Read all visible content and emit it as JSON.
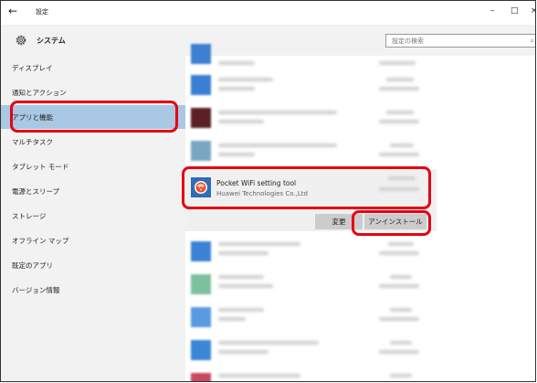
{
  "window": {
    "back_glyph": "←",
    "title": "設定",
    "controls": {
      "minimize": "–",
      "maximize": "□",
      "close": "×"
    }
  },
  "header": {
    "section_title": "システム",
    "search": {
      "placeholder": "設定の検索"
    }
  },
  "sidebar": {
    "items": [
      {
        "label": "ディスプレイ",
        "active": false
      },
      {
        "label": "通知とアクション",
        "active": false
      },
      {
        "label": "アプリと機能",
        "active": true
      },
      {
        "label": "マルチタスク",
        "active": false
      },
      {
        "label": "タブレット モード",
        "active": false
      },
      {
        "label": "電源とスリープ",
        "active": false
      },
      {
        "label": "ストレージ",
        "active": false
      },
      {
        "label": "オフライン マップ",
        "active": false
      },
      {
        "label": "既定のアプリ",
        "active": false
      },
      {
        "label": "バージョン情報",
        "active": false
      }
    ]
  },
  "apps": {
    "selected": {
      "name": "Pocket WiFi setting tool",
      "publisher": "Huawei Technologies Co.,Ltd",
      "modify_label": "変更",
      "uninstall_label": "アンインストール"
    }
  },
  "colors": {
    "accent_highlight": "#e60012",
    "selected_nav": "#a9c8e4",
    "sidebar_bg": "#f2f2f2"
  }
}
